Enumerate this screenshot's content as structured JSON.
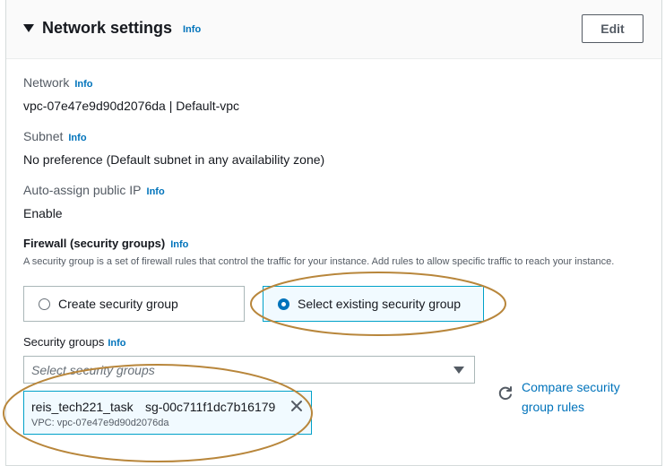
{
  "header": {
    "title": "Network settings",
    "info": "Info",
    "edit_label": "Edit"
  },
  "network": {
    "label": "Network",
    "info": "Info",
    "value": "vpc-07e47e9d90d2076da | Default-vpc"
  },
  "subnet": {
    "label": "Subnet",
    "info": "Info",
    "value": "No preference (Default subnet in any availability zone)"
  },
  "auto_assign": {
    "label": "Auto-assign public IP",
    "info": "Info",
    "value": "Enable"
  },
  "firewall": {
    "label": "Firewall (security groups)",
    "info": "Info",
    "description": "A security group is a set of firewall rules that control the traffic for your instance. Add rules to allow specific traffic to reach your instance.",
    "options": [
      {
        "label": "Create security group",
        "selected": false
      },
      {
        "label": "Select existing security group",
        "selected": true
      }
    ]
  },
  "security_groups": {
    "label": "Security groups",
    "info": "Info",
    "placeholder": "Select security groups",
    "token": {
      "name": "reis_tech221_task",
      "id": "sg-00c711f1dc7b16179",
      "vpc": "VPC: vpc-07e47e9d90d2076da"
    },
    "compare_link": "Compare security group rules"
  },
  "colors": {
    "link": "#0073bb",
    "selected_border": "#00a1c9",
    "selected_bg": "#f1faff",
    "annotation": "#b8863b"
  },
  "icons": [
    "caret-down-icon",
    "radio-icon",
    "dropdown-arrow-icon",
    "close-icon",
    "refresh-icon"
  ]
}
